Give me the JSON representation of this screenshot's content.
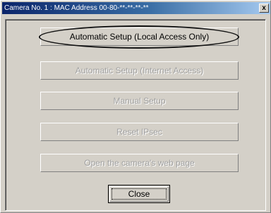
{
  "window": {
    "title": "Camera No. 1  :  MAC Address  00-80-**-**-**-**",
    "close_glyph": "x"
  },
  "buttons": {
    "auto_local": "Automatic Setup (Local Access Only)",
    "auto_internet": "Automatic Setup (Internet Access)",
    "manual": "Manual Setup",
    "reset_ipsec": "Reset  IPsec",
    "open_web": "Open the camera's web page",
    "close": "Close"
  }
}
